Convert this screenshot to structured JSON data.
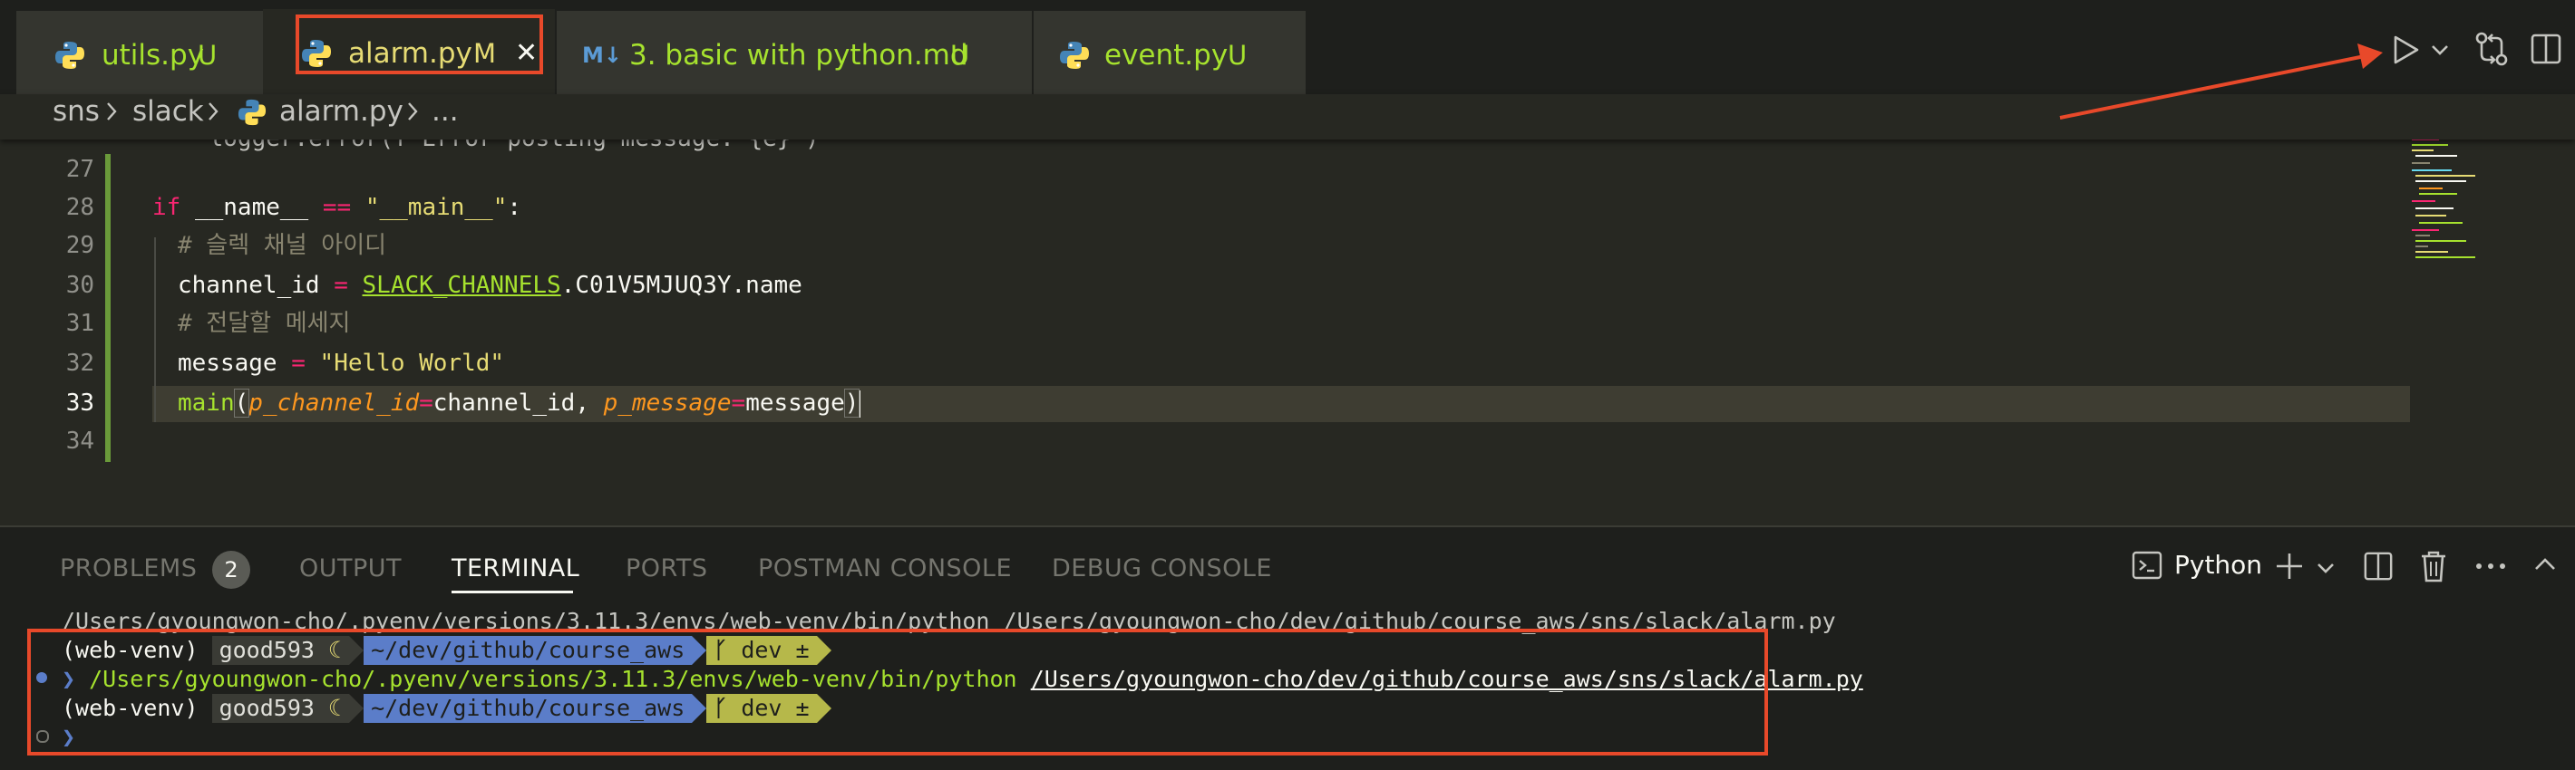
{
  "tabs": [
    {
      "name": "utils.py",
      "status": "U"
    },
    {
      "name": "alarm.py",
      "status": "M",
      "close": "✕"
    },
    {
      "name": "3. basic with python.md",
      "status": "U",
      "icon_text": "M↓"
    },
    {
      "name": "event.py",
      "status": "U"
    }
  ],
  "breadcrumb": {
    "items": [
      "sns",
      "slack",
      "alarm.py",
      "..."
    ]
  },
  "editor": {
    "lines": [
      {
        "num": "",
        "text": "    logger.error(f\"Error posting message: {e}\")"
      },
      {
        "num": "27"
      },
      {
        "num": "28"
      },
      {
        "num": "29"
      },
      {
        "num": "30"
      },
      {
        "num": "31"
      },
      {
        "num": "32"
      },
      {
        "num": "33"
      },
      {
        "num": "34"
      }
    ],
    "code": {
      "l28": {
        "kw": "if",
        "name": "__name__",
        "op": "==",
        "str": "\"__main__\"",
        "colon": ":"
      },
      "l29": "# 슬렉 채널 아이디",
      "l30": {
        "var": "channel_id",
        "eq": "=",
        "cls": "SLACK_CHANNELS",
        "rest": ".C01V5MJUQ3Y.name"
      },
      "l31": "# 전달할 메세지",
      "l32": {
        "var": "message",
        "eq": "=",
        "str": "\"Hello World\""
      },
      "l33": {
        "fn": "main",
        "p1": "p_channel_id",
        "v1": "channel_id",
        "sep": ", ",
        "p2": "p_message",
        "v2": "message"
      }
    }
  },
  "panel": {
    "tabs": [
      "PROBLEMS",
      "OUTPUT",
      "TERMINAL",
      "PORTS",
      "POSTMAN CONSOLE",
      "DEBUG CONSOLE"
    ],
    "problems_count": "2",
    "active_tab": "TERMINAL",
    "shell_label": "Python",
    "terminal": {
      "line1": "/Users/gyoungwon-cho/.pyenv/versions/3.11.3/envs/web-venv/bin/python /Users/gyoungwon-cho/dev/github/course_aws/sns/slack/alarm.py",
      "venv": "(web-venv)",
      "user": "good593",
      "moon": "☾",
      "dir": "~/dev/github/course_aws",
      "branch": "dev ±",
      "cmd_python": "/Users/gyoungwon-cho/.pyenv/versions/3.11.3/envs/web-venv/bin/python",
      "cmd_script": "/Users/gyoungwon-cho/dev/github/course_aws/sns/slack/alarm.py"
    }
  },
  "colors": {
    "highlight": "#e8492a",
    "accent_blue": "#5b7dc9",
    "accent_yellow": "#b6b84a"
  }
}
